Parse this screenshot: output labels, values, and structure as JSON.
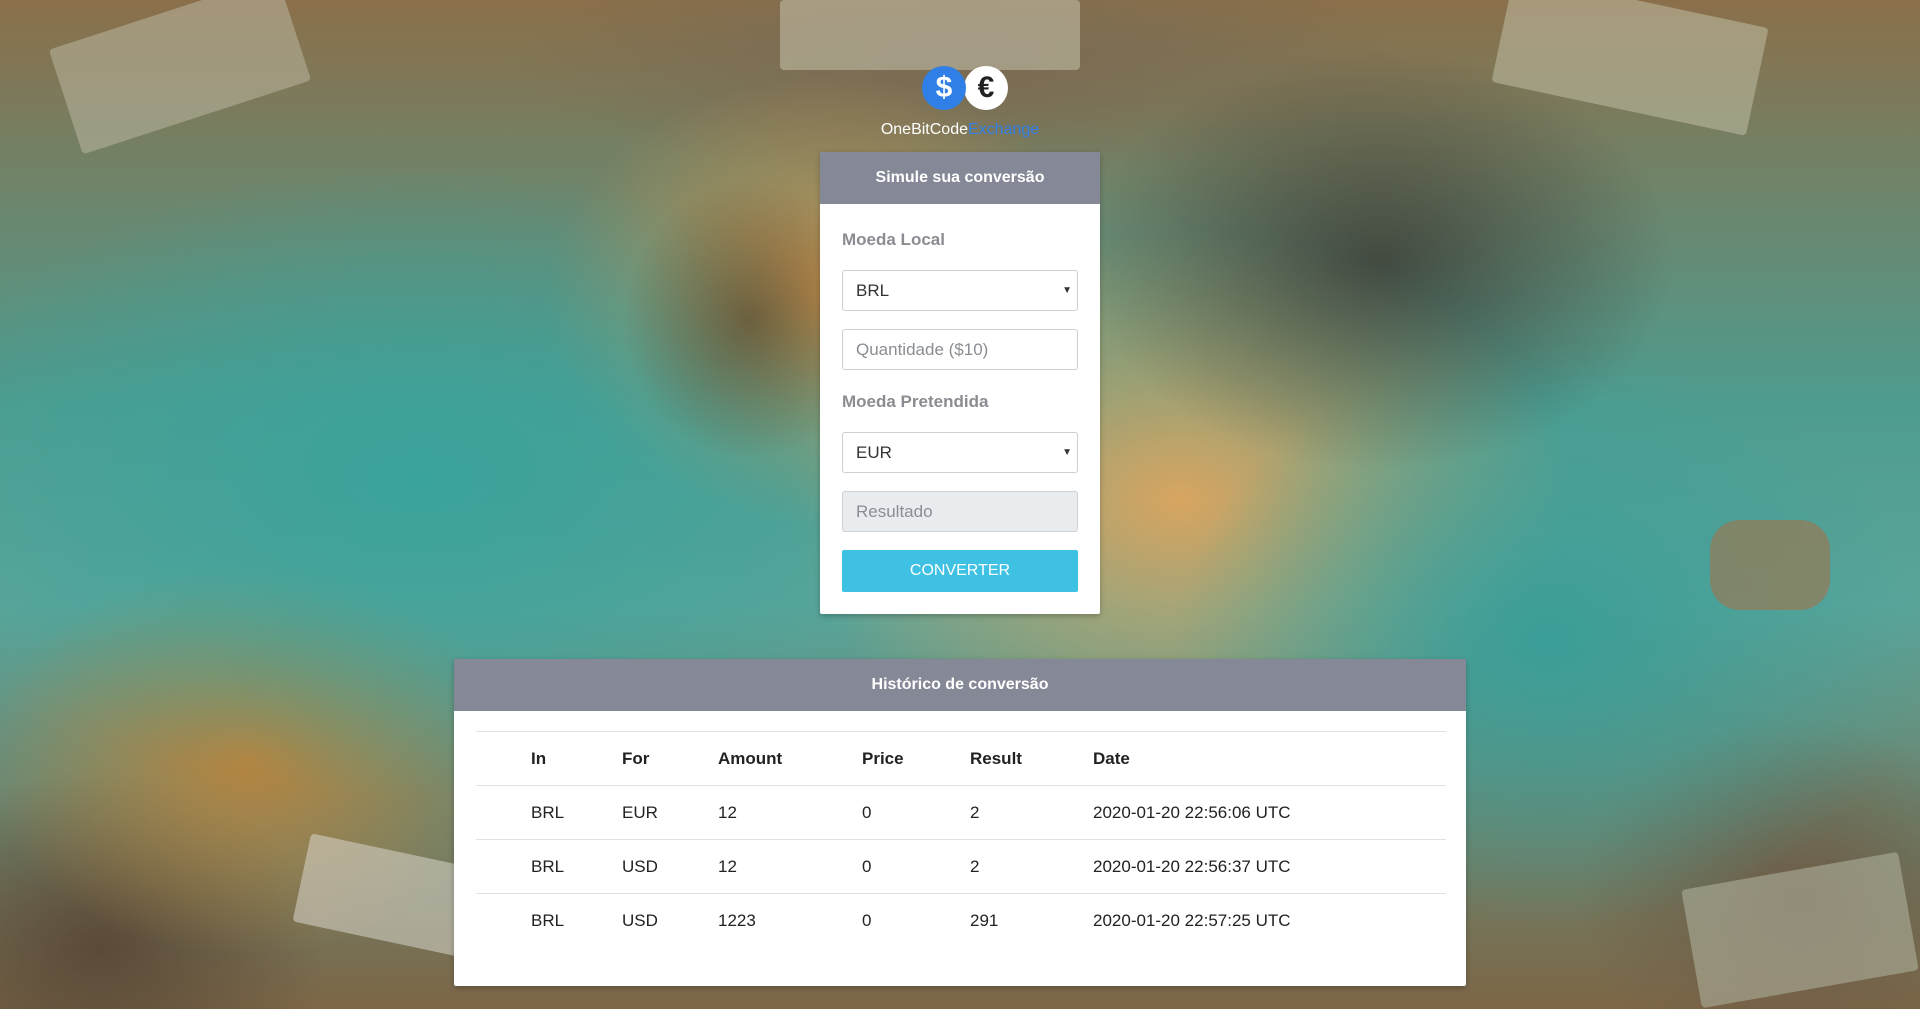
{
  "brand": {
    "name_part1": "OneBitCode",
    "name_part2": "Exchange",
    "dollar_symbol": "$",
    "euro_symbol": "€",
    "accent_color": "#2f7fe6"
  },
  "converter": {
    "title": "Simule sua conversão",
    "local_currency_label": "Moeda Local",
    "local_currency_value": "BRL",
    "amount_placeholder": "Quantidade ($10)",
    "target_currency_label": "Moeda Pretendida",
    "target_currency_value": "EUR",
    "result_placeholder": "Resultado",
    "button_label": "CONVERTER",
    "button_color": "#3ec1e3",
    "header_color": "#858896"
  },
  "history": {
    "title": "Histórico de conversão",
    "columns": [
      "In",
      "For",
      "Amount",
      "Price",
      "Result",
      "Date"
    ],
    "rows": [
      [
        "BRL",
        "EUR",
        "12",
        "0",
        "2",
        "2020-01-20 22:56:06 UTC"
      ],
      [
        "BRL",
        "USD",
        "12",
        "0",
        "2",
        "2020-01-20 22:56:37 UTC"
      ],
      [
        "BRL",
        "USD",
        "1223",
        "0",
        "291",
        "2020-01-20 22:57:25 UTC"
      ]
    ]
  }
}
